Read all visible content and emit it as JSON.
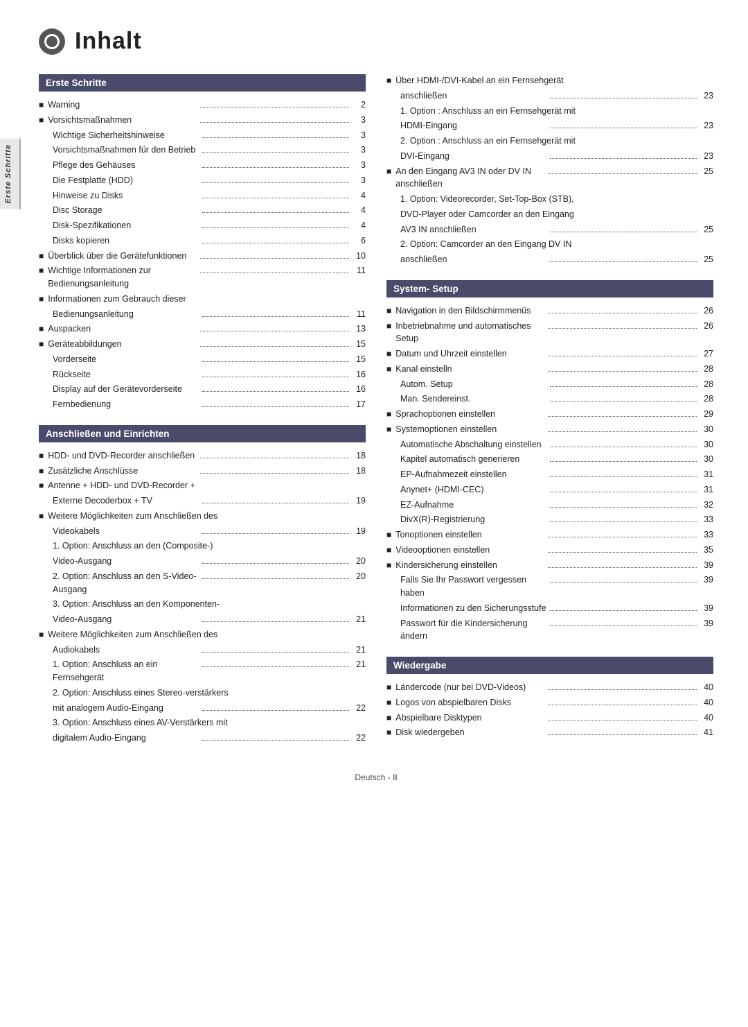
{
  "page": {
    "title": "Inhalt",
    "footer": "Deutsch - 8",
    "sidebar_label": "Erste Schritte"
  },
  "sections": {
    "erste_schritte": {
      "header": "Erste Schritte",
      "entries": [
        {
          "type": "bullet",
          "text": "Warning",
          "page": "2"
        },
        {
          "type": "bullet",
          "text": "Vorsichtsmaßnahmen",
          "page": "3"
        },
        {
          "type": "sub",
          "text": "Wichtige Sicherheitshinweise",
          "page": "3"
        },
        {
          "type": "sub",
          "text": "Vorsichtsmaßnahmen für den Betrieb",
          "page": "3"
        },
        {
          "type": "sub",
          "text": "Pflege des Gehäuses",
          "page": "3"
        },
        {
          "type": "sub",
          "text": "Die Festplatte (HDD)",
          "page": "3"
        },
        {
          "type": "sub",
          "text": "Hinweise zu Disks",
          "page": "4"
        },
        {
          "type": "sub",
          "text": "Disc Storage",
          "page": "4"
        },
        {
          "type": "sub",
          "text": "Disk-Spezifikationen",
          "page": "4"
        },
        {
          "type": "sub",
          "text": "Disks kopieren",
          "page": "6"
        },
        {
          "type": "bullet",
          "text": "Überblick über die Gerätefunktionen",
          "page": "10"
        },
        {
          "type": "bullet",
          "text": "Wichtige Informationen zur Bedienungsanleitung",
          "page": "11"
        },
        {
          "type": "bullet",
          "text": "Informationen zum Gebrauch dieser",
          "page": ""
        },
        {
          "type": "sub",
          "text": "Bedienungsanleitung",
          "page": "11"
        },
        {
          "type": "bullet",
          "text": "Auspacken",
          "page": "13"
        },
        {
          "type": "bullet",
          "text": "Geräteabbildungen",
          "page": "15"
        },
        {
          "type": "sub",
          "text": "Vorderseite",
          "page": "15"
        },
        {
          "type": "sub",
          "text": "Rückseite",
          "page": "16"
        },
        {
          "type": "sub",
          "text": "Display auf der Gerätevorderseite",
          "page": "16"
        },
        {
          "type": "sub",
          "text": "Fernbedienung",
          "page": "17"
        }
      ]
    },
    "anschliessen": {
      "header": "Anschließen und Einrichten",
      "entries": [
        {
          "type": "bullet",
          "text": "HDD- und DVD-Recorder anschließen",
          "page": "18"
        },
        {
          "type": "bullet",
          "text": "Zusätzliche Anschlüsse",
          "page": "18"
        },
        {
          "type": "bullet",
          "text": "Antenne + HDD- und DVD-Recorder +",
          "page": ""
        },
        {
          "type": "sub",
          "text": "Externe Decoderbox + TV",
          "page": "19"
        },
        {
          "type": "bullet",
          "text": "Weitere Möglichkeiten zum Anschließen des",
          "page": ""
        },
        {
          "type": "sub",
          "text": "Videokabels",
          "page": "19"
        },
        {
          "type": "sub2",
          "text": "1. Option: Anschluss an den (Composite-)",
          "page": ""
        },
        {
          "type": "sub2",
          "text": "Video-Ausgang",
          "page": "20"
        },
        {
          "type": "sub2",
          "text": "2. Option: Anschluss an den S-Video-Ausgang",
          "page": "20"
        },
        {
          "type": "sub2",
          "text": "3. Option: Anschluss an den Komponenten-",
          "page": ""
        },
        {
          "type": "sub2",
          "text": "Video-Ausgang",
          "page": "21"
        },
        {
          "type": "bullet",
          "text": "Weitere Möglichkeiten zum Anschließen des",
          "page": ""
        },
        {
          "type": "sub",
          "text": "Audiokabels",
          "page": "21"
        },
        {
          "type": "sub2",
          "text": "1. Option: Anschluss an ein Fernsehgerät",
          "page": "21"
        },
        {
          "type": "sub2",
          "text": "2. Option: Anschluss eines Stereo-verstärkers",
          "page": ""
        },
        {
          "type": "sub2",
          "text": "mit analogem Audio-Eingang",
          "page": "22"
        },
        {
          "type": "sub2",
          "text": "3. Option: Anschluss eines AV-Verstärkers mit",
          "page": ""
        },
        {
          "type": "sub2",
          "text": "digitalem Audio-Eingang",
          "page": "22"
        }
      ]
    },
    "right_col_top": {
      "entries": [
        {
          "type": "bullet",
          "text": "Über HDMI-/DVI-Kabel an ein Fernsehgerät",
          "page": ""
        },
        {
          "type": "sub",
          "text": "anschließen",
          "page": "23"
        },
        {
          "type": "sub2",
          "text": "1. Option : Anschluss an ein Fernsehgerät mit",
          "page": ""
        },
        {
          "type": "sub2",
          "text": "HDMI-Eingang",
          "page": "23"
        },
        {
          "type": "sub2",
          "text": "2. Option : Anschluss an ein Fernsehgerät mit",
          "page": ""
        },
        {
          "type": "sub2",
          "text": "DVI-Eingang",
          "page": "23"
        },
        {
          "type": "bullet",
          "text": "An den Eingang AV3 IN oder DV IN anschließen",
          "page": "25"
        },
        {
          "type": "sub2",
          "text": "1. Option: Videorecorder, Set-Top-Box (STB),",
          "page": ""
        },
        {
          "type": "sub2",
          "text": "DVD-Player oder Camcorder an den Eingang",
          "page": ""
        },
        {
          "type": "sub2",
          "text": "AV3 IN anschließen",
          "page": "25"
        },
        {
          "type": "sub2",
          "text": "2. Option: Camcorder an den Eingang DV IN",
          "page": ""
        },
        {
          "type": "sub2",
          "text": "anschließen",
          "page": "25"
        }
      ]
    },
    "system_setup": {
      "header": "System- Setup",
      "entries": [
        {
          "type": "bullet",
          "text": "Navigation in den Bildschirmmenüs",
          "page": "26"
        },
        {
          "type": "bullet",
          "text": "Inbetriebnahme und automatisches Setup",
          "page": "26"
        },
        {
          "type": "bullet",
          "text": "Datum und Uhrzeit einstellen",
          "page": "27"
        },
        {
          "type": "bullet",
          "text": "Kanal einstelln",
          "page": "28"
        },
        {
          "type": "sub",
          "text": "Autom. Setup",
          "page": "28"
        },
        {
          "type": "sub",
          "text": "Man. Sendereinst.",
          "page": "28"
        },
        {
          "type": "bullet",
          "text": "Sprachoptionen einstellen",
          "page": "29"
        },
        {
          "type": "bullet",
          "text": "Systemoptionen einstellen",
          "page": "30"
        },
        {
          "type": "sub",
          "text": "Automatische Abschaltung einstellen",
          "page": "30"
        },
        {
          "type": "sub",
          "text": "Kapitel automatisch generieren",
          "page": "30"
        },
        {
          "type": "sub",
          "text": "EP-Aufnahmezeit einstellen",
          "page": "31"
        },
        {
          "type": "sub",
          "text": "Anynet+ (HDMI-CEC)",
          "page": "31"
        },
        {
          "type": "sub",
          "text": "EZ-Aufnahme",
          "page": "32"
        },
        {
          "type": "sub",
          "text": "DivX(R)-Registrierung",
          "page": "33"
        },
        {
          "type": "bullet",
          "text": "Tonoptionen einstellen",
          "page": "33"
        },
        {
          "type": "bullet",
          "text": "Videooptionen einstellen",
          "page": "35"
        },
        {
          "type": "bullet",
          "text": "Kindersicherung einstellen",
          "page": "39"
        },
        {
          "type": "sub",
          "text": "Falls Sie Ihr Passwort vergessen haben",
          "page": "39"
        },
        {
          "type": "sub",
          "text": "Informationen zu den Sicherungsstufe",
          "page": "39"
        },
        {
          "type": "sub",
          "text": "Passwort für die Kindersicherung ändern",
          "page": "39"
        }
      ]
    },
    "wiedergabe": {
      "header": "Wiedergabe",
      "entries": [
        {
          "type": "bullet",
          "text": "Ländercode (nur bei DVD-Videos)",
          "page": "40"
        },
        {
          "type": "bullet",
          "text": "Logos von abspielbaren Disks",
          "page": "40"
        },
        {
          "type": "bullet",
          "text": "Abspielbare Disktypen",
          "page": "40"
        },
        {
          "type": "bullet",
          "text": "Disk wiedergeben",
          "page": "41"
        }
      ]
    }
  }
}
